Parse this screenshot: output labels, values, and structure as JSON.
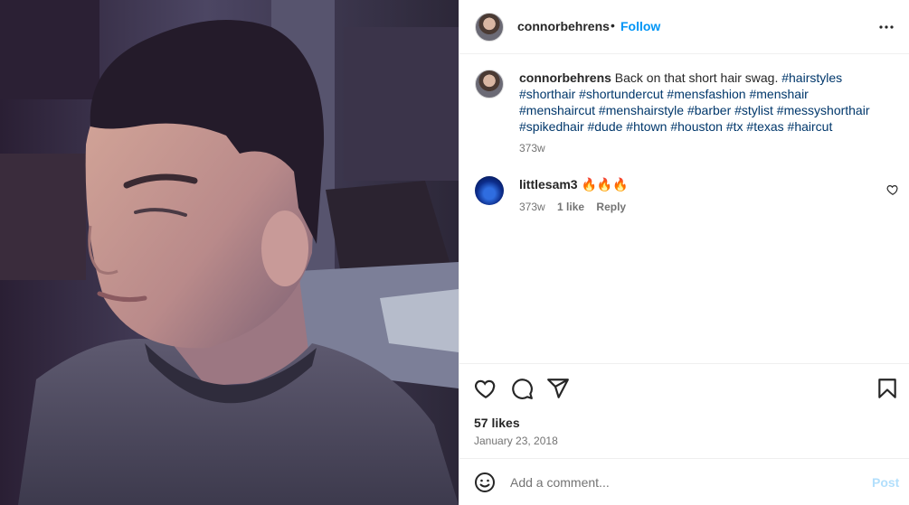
{
  "header": {
    "username": "connorbehrens",
    "separator": "•",
    "follow_label": "Follow",
    "more_icon": "more-horizontal-icon"
  },
  "caption": {
    "username": "connorbehrens",
    "text": "Back on that short hair swag.",
    "hashtags": "#hairstyles #shorthair #shortundercut #mensfashion #menshair #menshaircut #menshairstyle #barber #stylist #messyshorthair #spikedhair #dude #htown #houston #tx #texas #haircut",
    "time": "373w"
  },
  "comments": [
    {
      "username": "littlesam3",
      "text": "🔥🔥🔥",
      "time": "373w",
      "likes": "1 like",
      "reply_label": "Reply"
    }
  ],
  "actions": {
    "like_icon": "heart-icon",
    "comment_icon": "comment-icon",
    "share_icon": "send-icon",
    "save_icon": "bookmark-icon",
    "likes": "57 likes",
    "date": "January 23, 2018"
  },
  "composer": {
    "placeholder": "Add a comment...",
    "post_label": "Post"
  },
  "colors": {
    "link": "#0095f6",
    "hashtag": "#00376b",
    "muted": "#737373",
    "post_disabled": "#b2dffc"
  }
}
